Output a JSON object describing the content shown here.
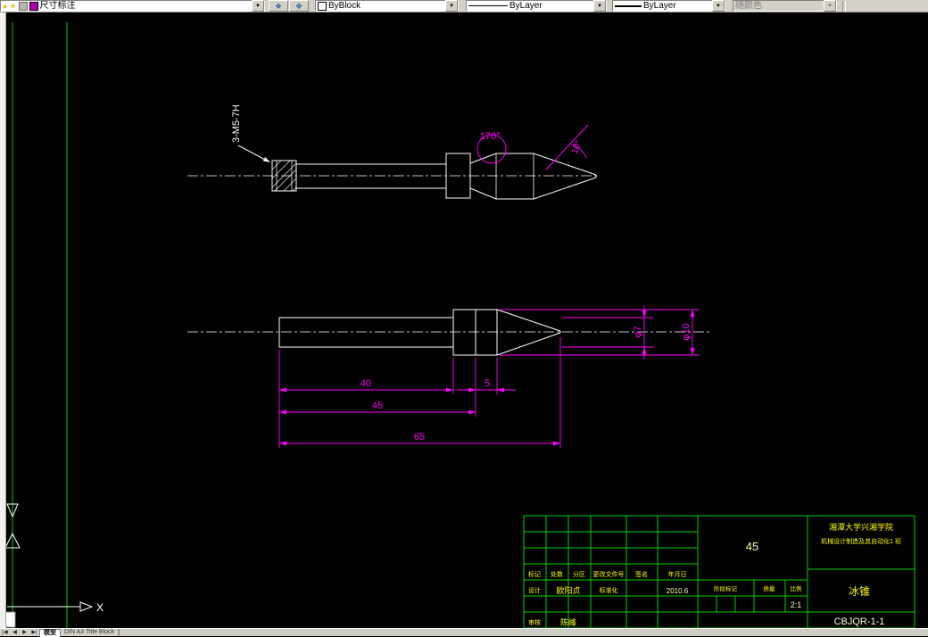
{
  "toolbar": {
    "layer": {
      "value": "尺寸标注"
    },
    "color": {
      "value": "ByBlock"
    },
    "linetype": {
      "value": "ByLayer"
    },
    "lineweight": {
      "value": "ByLayer"
    },
    "plotstyle": {
      "value": "随颜色"
    }
  },
  "icons": {
    "dropdown_arrow": "▼",
    "bulb": "●",
    "sun": "☀",
    "layer_tool": "❖",
    "nav_first": "|◀",
    "nav_prev": "◀",
    "nav_next": "▶",
    "nav_last": "▶|"
  },
  "drawing": {
    "thread_note": "3-M5-7H",
    "angle_dim_1": "170°",
    "angle_dim_2": "10°",
    "length_dim_1": "40",
    "length_dim_2": "45",
    "length_dim_3": "65",
    "length_dim_4": "5",
    "dia_dim_1": "φ7",
    "dia_dim_2": "φ10",
    "colors": {
      "outline": "#ffffff",
      "dimension": "#ff00ff",
      "frame": "#00d200",
      "titletext": "#ffff00"
    }
  },
  "ucs": {
    "x_axis_label": "X"
  },
  "title_block": {
    "material": "45",
    "org_line1": "湘潭大学兴湘学院",
    "org_line2": "机械设计制造及其自动化1 班",
    "part_name": "冰锥",
    "drawing_number": "CBJQR-1-1",
    "revision_header": [
      "标记",
      "处数",
      "分区",
      "更改文件号",
      "签名",
      "年月日"
    ],
    "design_label": "设计",
    "design_name": "欧阳贞",
    "standard_label": "标准化",
    "date_value": "2010.6",
    "review_label": "审核",
    "review_name": "陈峰",
    "stage_label": "阶段标记",
    "weight_label": "质量",
    "scale_label": "比例",
    "scale_value": "2:1"
  },
  "tabs": {
    "model": "模型",
    "layout1": "DIN A3 Title Block"
  }
}
